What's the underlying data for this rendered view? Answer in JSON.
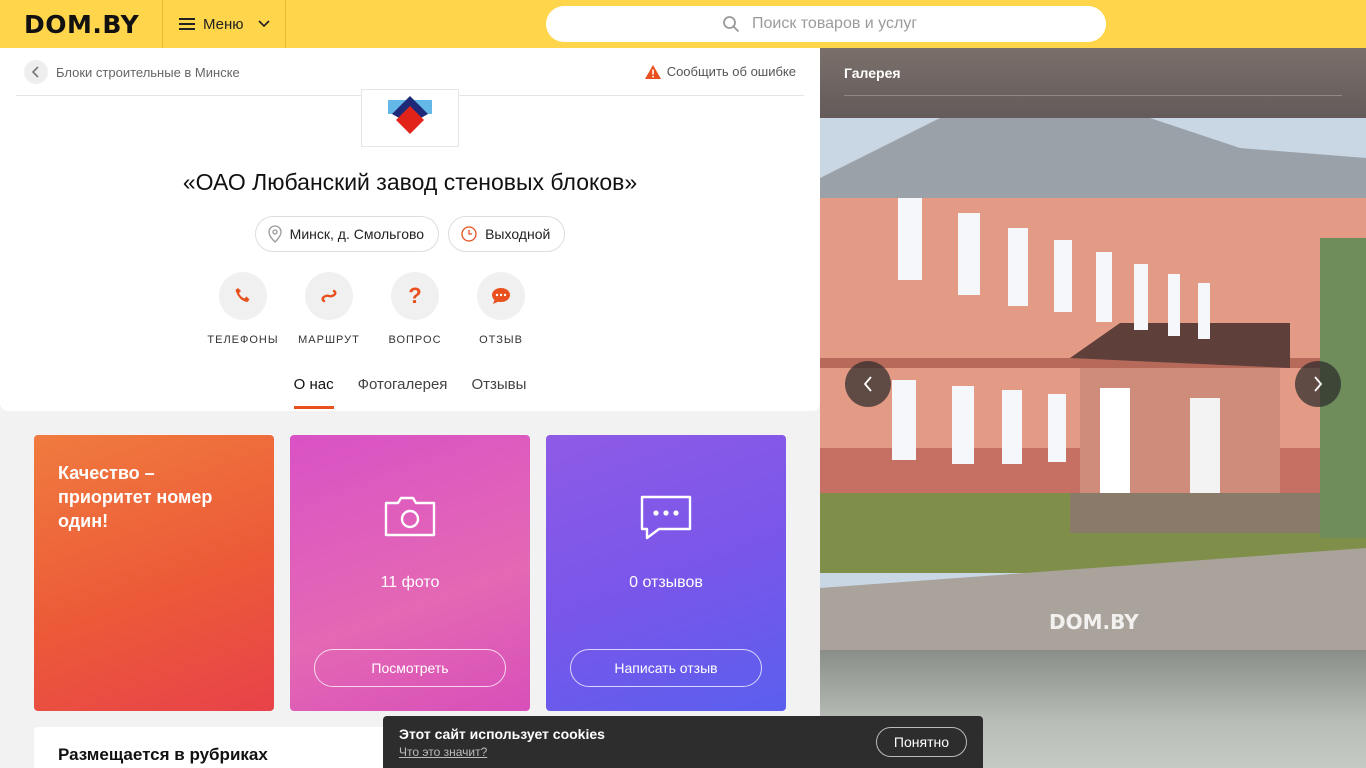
{
  "header": {
    "logo": "DOM.BY",
    "menu_label": "Меню",
    "search_placeholder": "Поиск товаров и услуг"
  },
  "breadcrumb": {
    "label": "Блоки строительные в Минске"
  },
  "report_label": "Сообщить об ошибке",
  "company": {
    "title": "«ОАО Любанский завод стеновых блоков»",
    "location": "Минск, д. Смольгово",
    "hours": "Выходной"
  },
  "actions": [
    {
      "label": "ТЕЛЕФОНЫ",
      "icon": "phone-icon"
    },
    {
      "label": "МАРШРУТ",
      "icon": "route-icon"
    },
    {
      "label": "ВОПРОС",
      "icon": "question-icon"
    },
    {
      "label": "ОТЗЫВ",
      "icon": "chat-icon"
    }
  ],
  "tabs": [
    {
      "label": "О нас",
      "active": true
    },
    {
      "label": "Фотогалерея",
      "active": false
    },
    {
      "label": "Отзывы",
      "active": false
    }
  ],
  "tiles": {
    "quality": "Качество – приоритет номер один!",
    "photos_count": "11 фото",
    "photos_button": "Посмотреть",
    "reviews_count": "0 отзывов",
    "reviews_button": "Написать отзыв"
  },
  "rubrics_title": "Размещается в рубриках",
  "gallery": {
    "title": "Галерея",
    "watermark": "DOM.BY"
  },
  "cookie": {
    "text": "Этот сайт использует cookies",
    "link": "Что это значит?",
    "button": "Понятно"
  },
  "colors": {
    "header_bg": "#ffd54b",
    "accent": "#e8501d"
  }
}
